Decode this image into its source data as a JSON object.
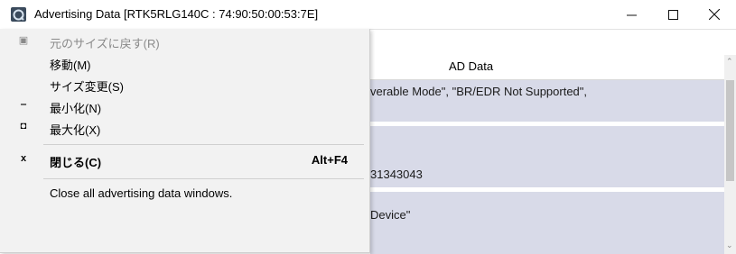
{
  "window": {
    "title": "Advertising Data [RTK5RLG140C : 74:90:50:00:53:7E]",
    "minimize_glyph": "—",
    "maximize_glyph": "☐",
    "close_glyph": "✕"
  },
  "table": {
    "header": "AD Data",
    "rows": [
      {
        "line1": "verable Mode\", \"BR/EDR Not Supported\",",
        "line2": ""
      },
      {
        "line1": "",
        "line2": "31343043"
      },
      {
        "line1": "Device\"",
        "line2": ""
      }
    ]
  },
  "system_menu": {
    "items": [
      {
        "label": "元のサイズに戻す(R)",
        "icon": "restore-icon",
        "glyph": "▣",
        "disabled": true
      },
      {
        "label": "移動(M)",
        "icon": "",
        "glyph": "",
        "disabled": false
      },
      {
        "label": "サイズ変更(S)",
        "icon": "",
        "glyph": "",
        "disabled": false
      },
      {
        "label": "最小化(N)",
        "icon": "minimize-icon",
        "glyph": "‒",
        "disabled": false
      },
      {
        "label": "最大化(X)",
        "icon": "maximize-icon",
        "glyph": "◘",
        "disabled": false
      },
      {
        "label": "閉じる(C)",
        "icon": "close-icon",
        "glyph": "x",
        "shortcut": "Alt+F4",
        "bold": true
      },
      {
        "label": "Close all advertising data windows.",
        "icon": "",
        "glyph": "",
        "disabled": false
      }
    ]
  },
  "colors": {
    "row_bg": "#d8dae8",
    "menu_bg": "#f2f2f2"
  }
}
